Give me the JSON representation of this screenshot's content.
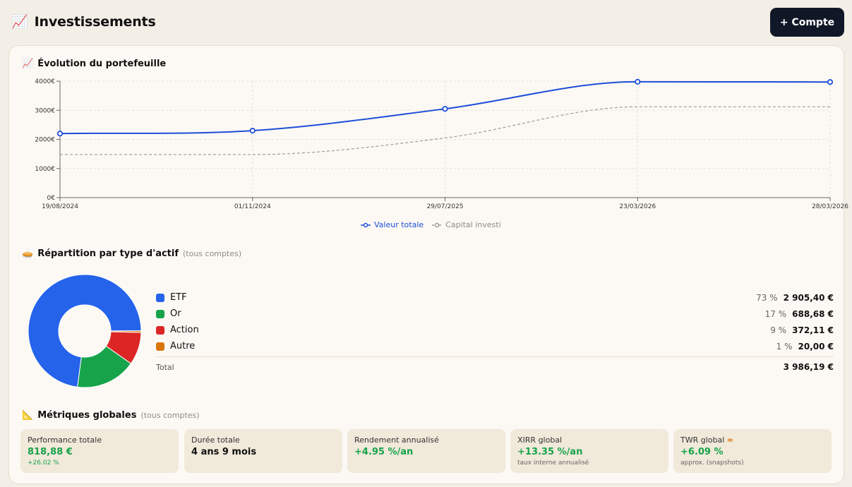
{
  "header": {
    "icon": "📈",
    "title": "Investissements",
    "add_account_label": "+ Compte"
  },
  "evolution": {
    "icon": "📈",
    "title": "Évolution du portefeuille"
  },
  "chart_data": {
    "type": "line",
    "title": "Évolution du portefeuille",
    "x": [
      "19/08/2024",
      "01/11/2024",
      "29/07/2025",
      "23/03/2026",
      "28/03/2026"
    ],
    "series": [
      {
        "name": "Valeur totale",
        "values": [
          2200,
          2300,
          3050,
          3980,
          3970
        ],
        "color": "#1d4ed8"
      },
      {
        "name": "Capital investi",
        "values": [
          1480,
          1480,
          2050,
          3120,
          3120
        ],
        "color": "#9a9a9a",
        "dashed": true
      }
    ],
    "y_ticks": [
      0,
      1000,
      2000,
      3000,
      4000
    ],
    "y_tick_labels": [
      "0€",
      "1000€",
      "2000€",
      "3000€",
      "4000€"
    ],
    "ylim": [
      0,
      4000
    ],
    "grid": true,
    "legend_position": "bottom"
  },
  "allocation": {
    "icon": "🥧",
    "title": "Répartition par type d'actif",
    "subtitle": "(tous comptes)",
    "items": [
      {
        "label": "ETF",
        "pct": "73 %",
        "amount": "2 905,40 €",
        "value": 2905.4,
        "color": "#2563eb"
      },
      {
        "label": "Or",
        "pct": "17 %",
        "amount": "688,68 €",
        "value": 688.68,
        "color": "#16a34a"
      },
      {
        "label": "Action",
        "pct": "9 %",
        "amount": "372,11 €",
        "value": 372.11,
        "color": "#dc2626"
      },
      {
        "label": "Autre",
        "pct": "1 %",
        "amount": "20,00 €",
        "value": 20.0,
        "color": "#d97706"
      }
    ],
    "total_label": "Total",
    "total_amount": "3 986,19 €"
  },
  "metrics": {
    "icon": "📐",
    "title": "Métriques globales",
    "subtitle": "(tous comptes)",
    "cards": [
      {
        "label": "Performance totale",
        "value": "818,88 €",
        "sub": "+26.02 %",
        "value_color": "green",
        "sub_color": "green"
      },
      {
        "label": "Durée totale",
        "value": "4 ans 9 mois",
        "sub": "",
        "value_color": "dark",
        "sub_color": ""
      },
      {
        "label": "Rendement annualisé",
        "value": "+4.95 %/an",
        "sub": "",
        "value_color": "green",
        "sub_color": ""
      },
      {
        "label": "XIRR global",
        "value": "+13.35 %/an",
        "sub": "taux interne annualisé",
        "value_color": "green",
        "sub_color": "gray"
      },
      {
        "label": "TWR global",
        "label_mark": "≈",
        "value": "+6.09 %",
        "sub": "approx. (snapshots)",
        "value_color": "green",
        "sub_color": "gray"
      }
    ]
  }
}
